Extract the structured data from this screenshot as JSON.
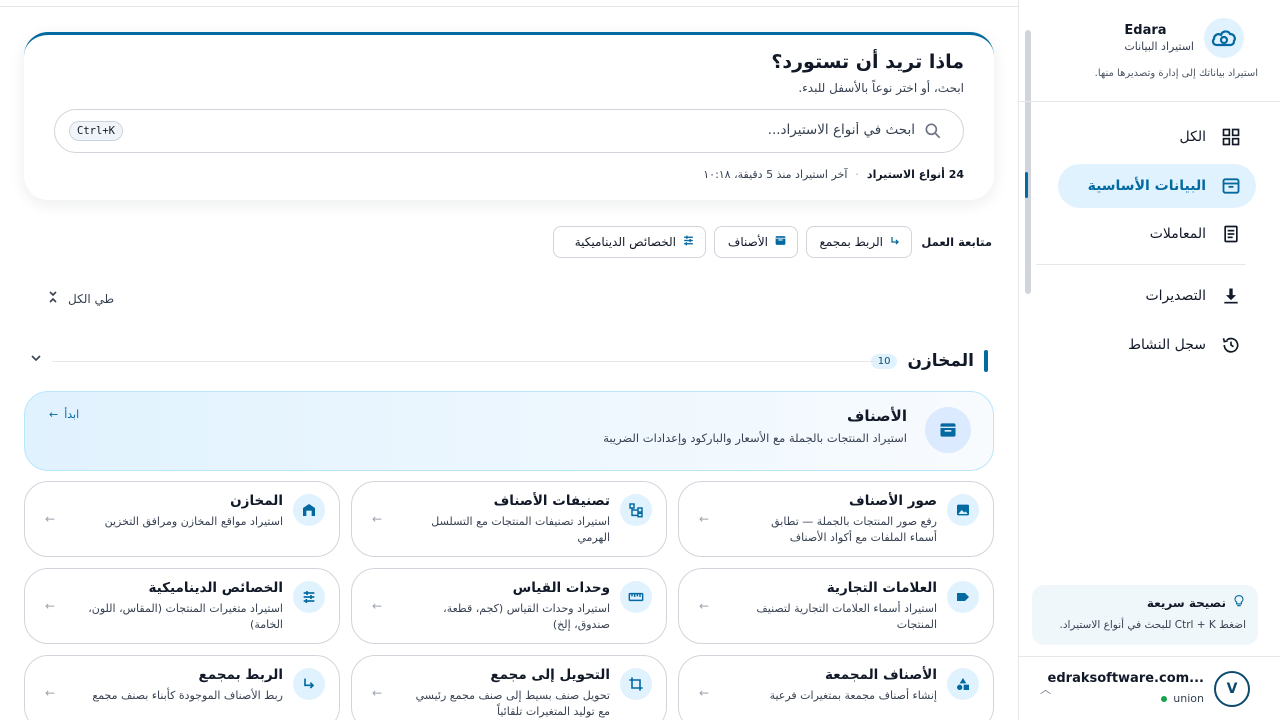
{
  "sidebar": {
    "brand_name": "Edara",
    "brand_sub": "استيراد البيانات",
    "brand_desc": "استيراد بياناتك إلى إدارة وتصديرها منها.",
    "nav": [
      {
        "label": "الكل",
        "icon": "grid-icon"
      },
      {
        "label": "البيانات الأساسية",
        "icon": "archive-icon",
        "active": true
      },
      {
        "label": "المعاملات",
        "icon": "receipt-icon"
      },
      {
        "label": "التصديرات",
        "icon": "download-icon"
      },
      {
        "label": "سجل النشاط",
        "icon": "history-icon"
      }
    ],
    "tip": {
      "title": "نصيحة سريعة",
      "text": "اضغط Ctrl + K للبحث في أنواع الاستيراد."
    },
    "user": {
      "initial": "V",
      "email": "edraksoftware.com...",
      "org": "union"
    }
  },
  "hero": {
    "title": "ماذا تريد أن تستورد؟",
    "subtitle": "ابحث، أو اختر نوعاً بالأسفل للبدء.",
    "search_placeholder": "ابحث في أنواع الاستيراد...",
    "shortcut": "Ctrl+K",
    "types_count": "24 أنواع الاستيراد",
    "last_import": "آخر استيراد منذ 5 دقيقة، ١٠:١٨"
  },
  "continue": {
    "label": "متابعة العمل",
    "chips": [
      "الربط بمجمع",
      "الأصناف",
      "الخصائص الديناميكية"
    ]
  },
  "collapse_all": "طي الكل",
  "section": {
    "title": "المخازن",
    "count": "10"
  },
  "featured": {
    "title": "الأصناف",
    "desc": "استيراد المنتجات بالجملة مع الأسعار والباركود وإعدادات الضريبة",
    "start": "ابدأ"
  },
  "cards": [
    {
      "title": "صور الأصناف",
      "desc": "رفع صور المنتجات بالجملة — تطابق أسماء الملفات مع أكواد الأصناف",
      "icon": "image-icon"
    },
    {
      "title": "تصنيفات الأصناف",
      "desc": "استيراد تصنيفات المنتجات مع التسلسل الهرمي",
      "icon": "hierarchy-icon"
    },
    {
      "title": "المخازن",
      "desc": "استيراد مواقع المخازن ومرافق التخزين",
      "icon": "warehouse-icon"
    },
    {
      "title": "العلامات التجارية",
      "desc": "استيراد أسماء العلامات التجارية لتصنيف المنتجات",
      "icon": "tag-icon"
    },
    {
      "title": "وحدات القياس",
      "desc": "استيراد وحدات القياس (كجم، قطعة، صندوق، إلخ)",
      "icon": "ruler-icon"
    },
    {
      "title": "الخصائص الديناميكية",
      "desc": "استيراد متغيرات المنتجات (المقاس، اللون، الخامة)",
      "icon": "sliders-icon"
    },
    {
      "title": "الأصناف المجمعة",
      "desc": "إنشاء أصناف مجمعة بمتغيرات فرعية",
      "icon": "shapes-icon"
    },
    {
      "title": "التحويل إلى مجمع",
      "desc": "تحويل صنف بسيط إلى صنف مجمع رئيسي مع توليد المتغيرات تلقائياً",
      "icon": "crop-icon"
    },
    {
      "title": "الربط بمجمع",
      "desc": "ربط الأصناف الموجودة كأبناء بصنف مجمع",
      "icon": "link-arrow-icon"
    }
  ]
}
